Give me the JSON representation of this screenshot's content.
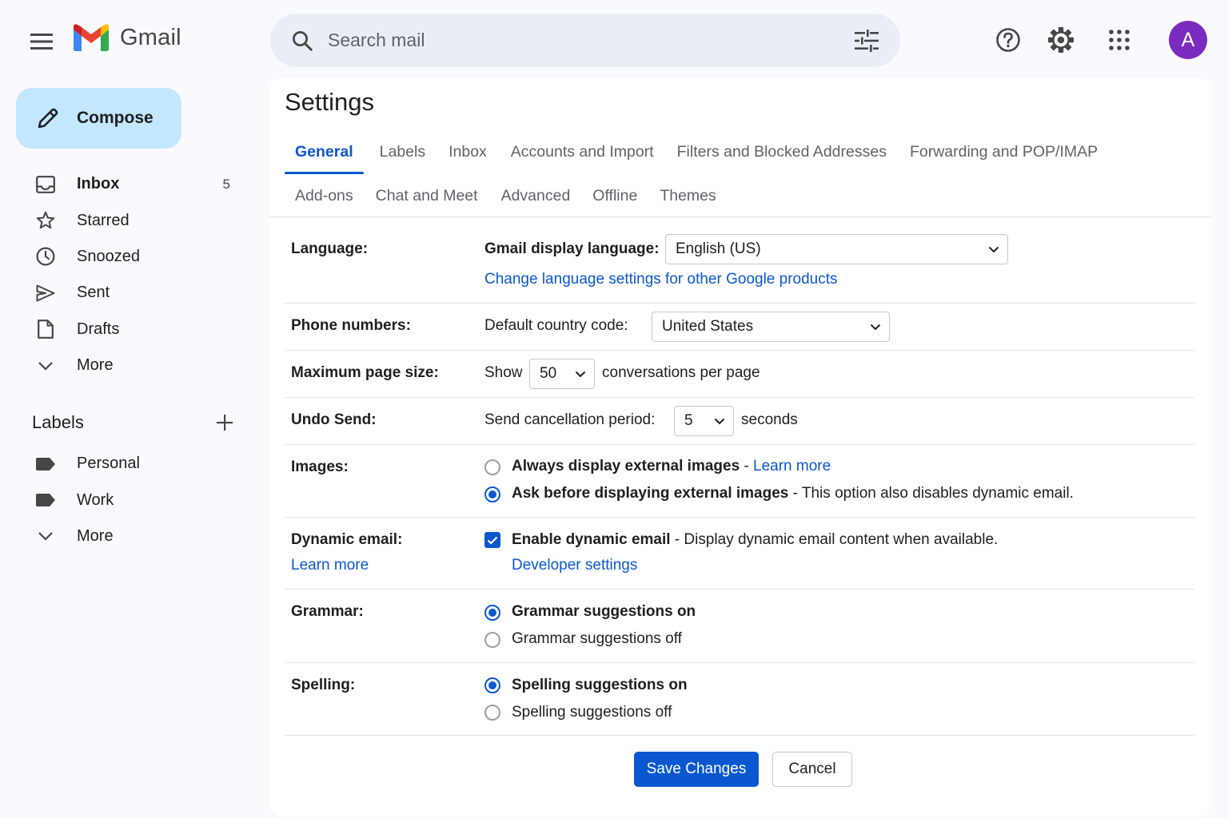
{
  "header": {
    "app_name": "Gmail",
    "search_placeholder": "Search mail",
    "avatar_initial": "A",
    "avatar_color": "#7b2bbf",
    "icons": [
      "menu-icon",
      "gmail-logo",
      "search-icon",
      "tune-icon",
      "help-icon",
      "gear-icon",
      "apps-icon"
    ]
  },
  "sidebar": {
    "compose_label": "Compose",
    "items": [
      {
        "label": "Inbox",
        "count": "5",
        "icon": "inbox-icon",
        "bold": true
      },
      {
        "label": "Starred",
        "count": "",
        "icon": "star-icon"
      },
      {
        "label": "Snoozed",
        "count": "",
        "icon": "clock-icon"
      },
      {
        "label": "Sent",
        "count": "",
        "icon": "send-icon"
      },
      {
        "label": "Drafts",
        "count": "",
        "icon": "draft-icon"
      },
      {
        "label": "More",
        "count": "",
        "icon": "chevron-down-icon"
      }
    ],
    "labels_title": "Labels",
    "labels": [
      {
        "label": "Personal",
        "icon": "label-icon"
      },
      {
        "label": "Work",
        "icon": "label-icon"
      },
      {
        "label": "More",
        "icon": "chevron-down-icon"
      }
    ]
  },
  "settings": {
    "title": "Settings",
    "tabs_row1": [
      "General",
      "Labels",
      "Inbox",
      "Accounts and Import",
      "Filters and Blocked Addresses",
      "Forwarding and POP/IMAP"
    ],
    "tabs_row2": [
      "Add-ons",
      "Chat and Meet",
      "Advanced",
      "Offline",
      "Themes"
    ],
    "active_tab": "General",
    "language": {
      "label": "Language:",
      "display_label": "Gmail display language:",
      "value": "English (US)",
      "link": "Change language settings for other Google products"
    },
    "phone": {
      "label": "Phone numbers:",
      "code_label": "Default country code:",
      "value": "United States"
    },
    "page_size": {
      "label": "Maximum page size:",
      "prefix": "Show",
      "value": "50",
      "suffix": "conversations per page"
    },
    "undo_send": {
      "label": "Undo Send:",
      "prefix": "Send cancellation period:",
      "value": "5",
      "suffix": "seconds"
    },
    "images": {
      "label": "Images:",
      "opt1_bold": "Always display external images",
      "opt1_sep": " - ",
      "opt1_link": "Learn more",
      "opt2_bold": "Ask before displaying external images",
      "opt2_rest": " - This option also disables dynamic email.",
      "selected": 2
    },
    "dynamic_email": {
      "label": "Dynamic email:",
      "label_link": "Learn more",
      "check_bold": "Enable dynamic email",
      "check_rest": " - Display dynamic email content when available.",
      "checked": true,
      "dev_link": "Developer settings"
    },
    "grammar": {
      "label": "Grammar:",
      "opt_on": "Grammar suggestions on",
      "opt_off": "Grammar suggestions off",
      "selected": "on"
    },
    "spelling": {
      "label": "Spelling:",
      "opt_on": "Spelling suggestions on",
      "opt_off": "Spelling suggestions off",
      "selected": "on"
    },
    "save_label": "Save Changes",
    "cancel_label": "Cancel"
  },
  "colors": {
    "accent": "#0b57d0",
    "compose_bg": "#c2e7ff",
    "search_bg": "#e9eef6",
    "page_bg": "#f8fafd"
  }
}
